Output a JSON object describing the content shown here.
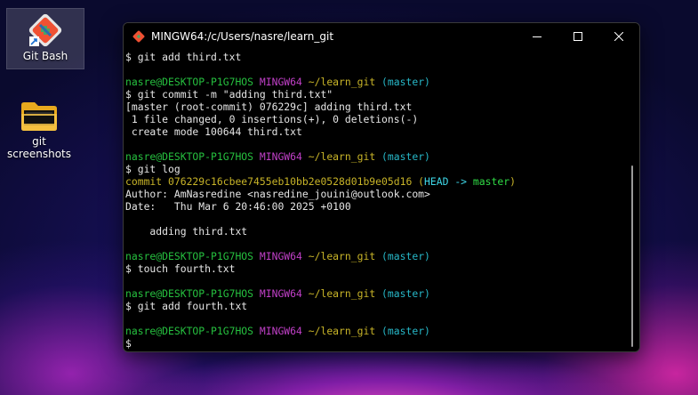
{
  "desktop": {
    "icons": [
      {
        "label": "Git Bash"
      },
      {
        "label": "git screenshots"
      }
    ]
  },
  "window": {
    "title": "MINGW64:/c/Users/nasre/learn_git",
    "controls": {
      "minimize": "─",
      "maximize": "☐",
      "close": "✕"
    }
  },
  "terminal": {
    "lines": [
      [
        {
          "t": "$ git add third.txt",
          "c": "white"
        }
      ],
      [],
      [
        {
          "t": "nasre@DESKTOP-P1G7HOS",
          "c": "green"
        },
        {
          "t": " "
        },
        {
          "t": "MINGW64",
          "c": "magenta"
        },
        {
          "t": " "
        },
        {
          "t": "~/learn_git",
          "c": "yellow"
        },
        {
          "t": " "
        },
        {
          "t": "(master)",
          "c": "cyan"
        }
      ],
      [
        {
          "t": "$ git commit -m \"adding third.txt\"",
          "c": "white"
        }
      ],
      [
        {
          "t": "[master (root-commit) 076229c] adding third.txt",
          "c": "white"
        }
      ],
      [
        {
          "t": " 1 file changed, 0 insertions(+), 0 deletions(-)",
          "c": "white"
        }
      ],
      [
        {
          "t": " create mode 100644 third.txt",
          "c": "white"
        }
      ],
      [],
      [
        {
          "t": "nasre@DESKTOP-P1G7HOS",
          "c": "green"
        },
        {
          "t": " "
        },
        {
          "t": "MINGW64",
          "c": "magenta"
        },
        {
          "t": " "
        },
        {
          "t": "~/learn_git",
          "c": "yellow"
        },
        {
          "t": " "
        },
        {
          "t": "(master)",
          "c": "cyan"
        }
      ],
      [
        {
          "t": "$ git log",
          "c": "white"
        }
      ],
      [
        {
          "t": "commit 076229c16cbee7455eb10bb2e0528d01b9e05d16 (",
          "c": "yellow"
        },
        {
          "t": "HEAD -> ",
          "c": "cyanb"
        },
        {
          "t": "master",
          "c": "lgreen"
        },
        {
          "t": ")",
          "c": "yellow"
        }
      ],
      [
        {
          "t": "Author: AmNasredine <nasredine_jouini@outlook.com>",
          "c": "white"
        }
      ],
      [
        {
          "t": "Date:   Thu Mar 6 20:46:00 2025 +0100",
          "c": "white"
        }
      ],
      [],
      [
        {
          "t": "    adding third.txt",
          "c": "white"
        }
      ],
      [],
      [
        {
          "t": "nasre@DESKTOP-P1G7HOS",
          "c": "green"
        },
        {
          "t": " "
        },
        {
          "t": "MINGW64",
          "c": "magenta"
        },
        {
          "t": " "
        },
        {
          "t": "~/learn_git",
          "c": "yellow"
        },
        {
          "t": " "
        },
        {
          "t": "(master)",
          "c": "cyan"
        }
      ],
      [
        {
          "t": "$ touch fourth.txt",
          "c": "white"
        }
      ],
      [],
      [
        {
          "t": "nasre@DESKTOP-P1G7HOS",
          "c": "green"
        },
        {
          "t": " "
        },
        {
          "t": "MINGW64",
          "c": "magenta"
        },
        {
          "t": " "
        },
        {
          "t": "~/learn_git",
          "c": "yellow"
        },
        {
          "t": " "
        },
        {
          "t": "(master)",
          "c": "cyan"
        }
      ],
      [
        {
          "t": "$ git add fourth.txt",
          "c": "white"
        }
      ],
      [],
      [
        {
          "t": "nasre@DESKTOP-P1G7HOS",
          "c": "green"
        },
        {
          "t": " "
        },
        {
          "t": "MINGW64",
          "c": "magenta"
        },
        {
          "t": " "
        },
        {
          "t": "~/learn_git",
          "c": "yellow"
        },
        {
          "t": " "
        },
        {
          "t": "(master)",
          "c": "cyan"
        }
      ],
      [
        {
          "t": "$",
          "c": "white"
        }
      ]
    ]
  }
}
